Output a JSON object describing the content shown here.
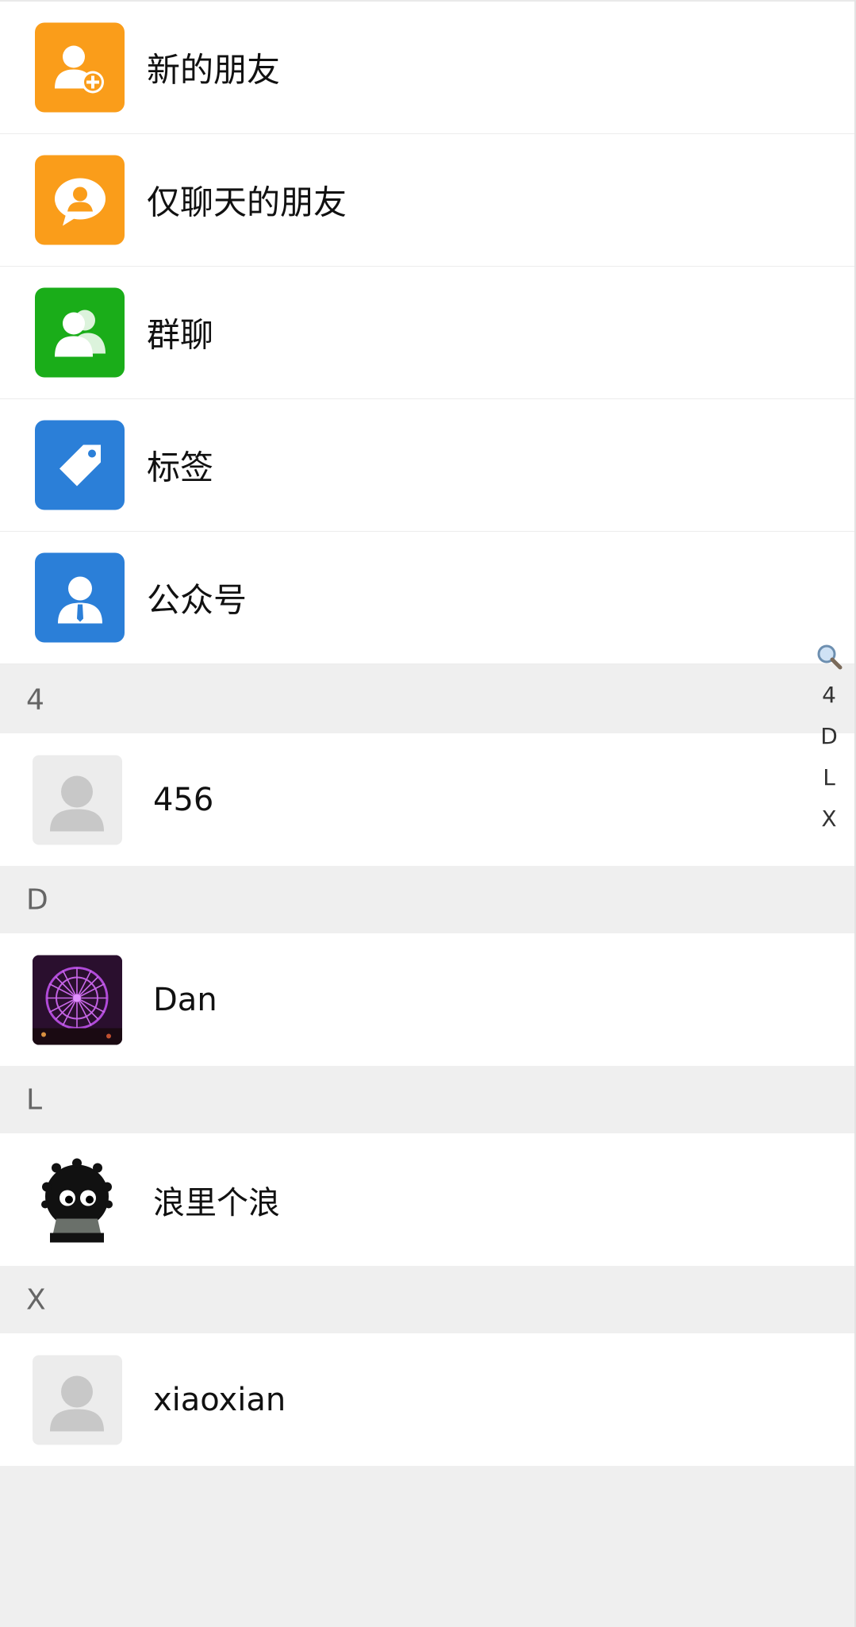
{
  "function_rows": [
    {
      "label": "新的朋友",
      "icon": "add-friend-icon",
      "color": "#fa9d1a"
    },
    {
      "label": "仅聊天的朋友",
      "icon": "chat-friend-icon",
      "color": "#fa9d1a"
    },
    {
      "label": "群聊",
      "icon": "group-icon",
      "color": "#1aad19"
    },
    {
      "label": "标签",
      "icon": "tag-icon",
      "color": "#2b7fd8"
    },
    {
      "label": "公众号",
      "icon": "official-account-icon",
      "color": "#2b7fd8"
    }
  ],
  "sections": [
    {
      "letter": "4",
      "contacts": [
        {
          "name": "456",
          "avatar": "default-avatar-icon"
        }
      ]
    },
    {
      "letter": "D",
      "contacts": [
        {
          "name": "Dan",
          "avatar": "ferris-wheel-photo"
        }
      ]
    },
    {
      "letter": "L",
      "contacts": [
        {
          "name": "浪里个浪",
          "avatar": "soot-sprite-avatar"
        }
      ]
    },
    {
      "letter": "X",
      "contacts": [
        {
          "name": "xiaoxian",
          "avatar": "default-avatar-icon"
        }
      ]
    }
  ],
  "index_bar": {
    "search_icon": "search-icon",
    "letters": [
      "4",
      "D",
      "L",
      "X"
    ]
  }
}
